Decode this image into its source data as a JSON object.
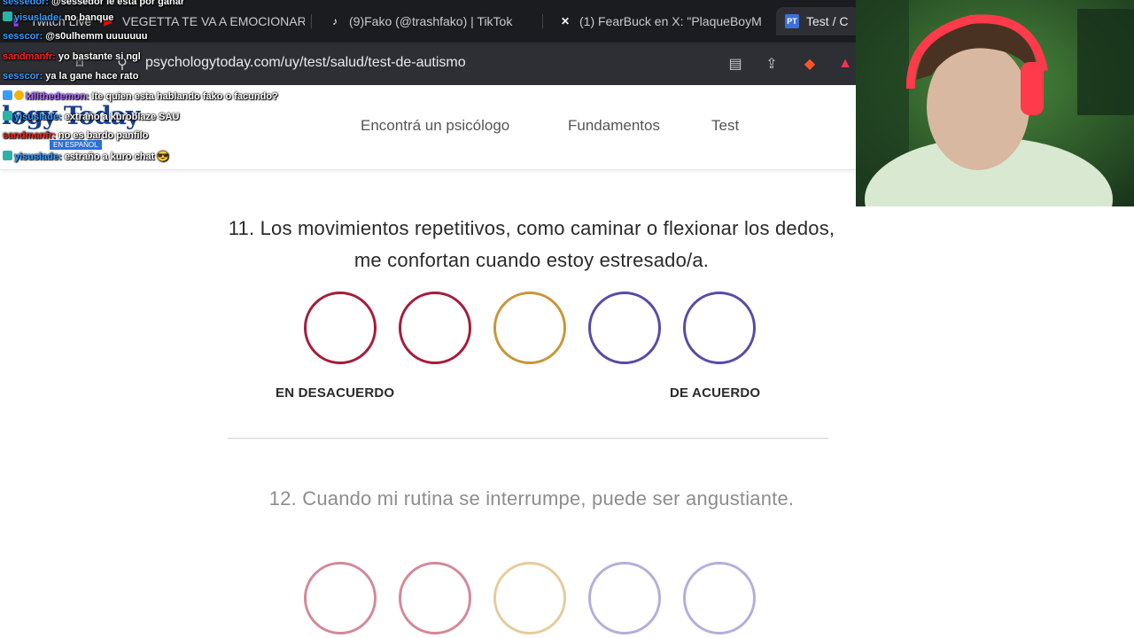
{
  "browser": {
    "tabs": [
      {
        "label": "Twitch Live",
        "icon": "twitch-icon"
      },
      {
        "label": "VEGETTA TE VA A EMOCIONAR",
        "icon": "youtube-icon"
      },
      {
        "label": "(9)Fako (@trashfako) | TikTok",
        "icon": "tiktok-icon"
      },
      {
        "label": "(1) FearBuck en X: \"PlaqueBoyM",
        "icon": "x-icon"
      },
      {
        "label": "Test / C",
        "icon": "pt-icon",
        "fav_text": "PT"
      }
    ],
    "url": "psychologytoday.com/uy/test/salud/test-de-autismo"
  },
  "site": {
    "logo": "logy Today",
    "logo_sub": "EN ESPAÑOL",
    "nav": [
      "Encontrá un psicólogo",
      "Fundamentos",
      "Test"
    ]
  },
  "questions": [
    {
      "text": "11. Los movimientos repetitivos, como caminar o flexionar los dedos, me confortan cuando estoy estresado/a."
    },
    {
      "text": "12. Cuando mi rutina se interrumpe, puede ser angustiante."
    }
  ],
  "scale": {
    "left": "EN DESACUERDO",
    "right": "DE ACUERDO"
  },
  "colors": {
    "disagree": "#a51c3c",
    "neutral": "#c9963a",
    "agree": "#5a4aa8",
    "disagree_faded": "#d48898",
    "neutral_faded": "#e6cb9c",
    "agree_faded": "#b5aedb",
    "chat_user_blue": "#3a9bff",
    "chat_user_red": "#ff2020",
    "chat_user_purple": "#b26bff"
  },
  "chat": [
    {
      "user": "sessedor:",
      "msg": "@sessedor le esta por ganar",
      "color": "#3a9bff"
    },
    {
      "user": "yisuslade:",
      "msg": "no banque",
      "color": "#3a9bff"
    },
    {
      "user": "sesscor:",
      "msg": "@s0ulhemm uuuuuuu",
      "color": "#3a9bff"
    },
    {
      "user": "sandmanfr:",
      "msg": "yo bastante si ngl",
      "color": "#ff2020"
    },
    {
      "user": "sesscor:",
      "msg": "ya la gane hace rato",
      "color": "#3a9bff"
    },
    {
      "user": "killthedemon:",
      "msg": "Ite quien esta hablando fako o facundo?",
      "color": "#b26bff"
    },
    {
      "user": "yisuslade:",
      "msg": "extraño a kuroblaze SAU",
      "color": "#3a9bff"
    },
    {
      "user": "sandmanfr:",
      "msg": "no es bardo panfilo",
      "color": "#ff2020"
    },
    {
      "user": "yisuslade:",
      "msg": "estraño a kuro chat 😎",
      "color": "#3a9bff"
    }
  ]
}
